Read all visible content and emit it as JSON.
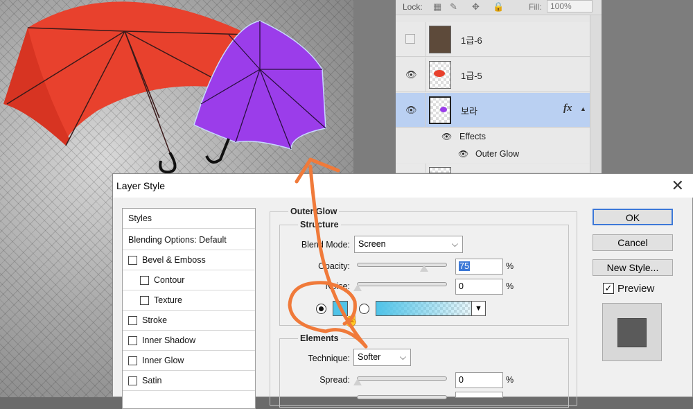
{
  "layers_panel": {
    "lock_label": "Lock:",
    "fill_label": "Fill:",
    "fill_value": "100%",
    "layers": [
      {
        "name": "1급-6",
        "visible": false
      },
      {
        "name": "1급-5",
        "visible": true
      },
      {
        "name": "보라",
        "visible": true,
        "selected": true,
        "fx": "fx"
      }
    ],
    "effects_label": "Effects",
    "effect_item": "Outer Glow"
  },
  "dialog": {
    "title": "Layer Style",
    "sidebar": {
      "styles": "Styles",
      "blending": "Blending Options: Default",
      "items": [
        "Bevel & Emboss",
        "Contour",
        "Texture",
        "Stroke",
        "Inner Shadow",
        "Inner Glow",
        "Satin"
      ]
    },
    "outer_glow": {
      "section": "Outer Glow",
      "structure": "Structure",
      "blend_mode_label": "Blend Mode:",
      "blend_mode_value": "Screen",
      "opacity_label": "Opacity:",
      "opacity_value": "75",
      "opacity_level": 0.75,
      "noise_label": "Noise:",
      "noise_value": "0",
      "percent": "%",
      "glow_color": "#4fc3e8",
      "elements": "Elements",
      "technique_label": "Technique:",
      "technique_value": "Softer",
      "spread_label": "Spread:",
      "spread_value": "0"
    },
    "buttons": {
      "ok": "OK",
      "cancel": "Cancel",
      "new_style": "New Style...",
      "preview": "Preview"
    }
  },
  "colors": {
    "accent_selection": "#bad0f2",
    "annotation_orange": "#f07a3a",
    "umbrella_red": "#e8412d",
    "umbrella_purple": "#9b3dea"
  }
}
